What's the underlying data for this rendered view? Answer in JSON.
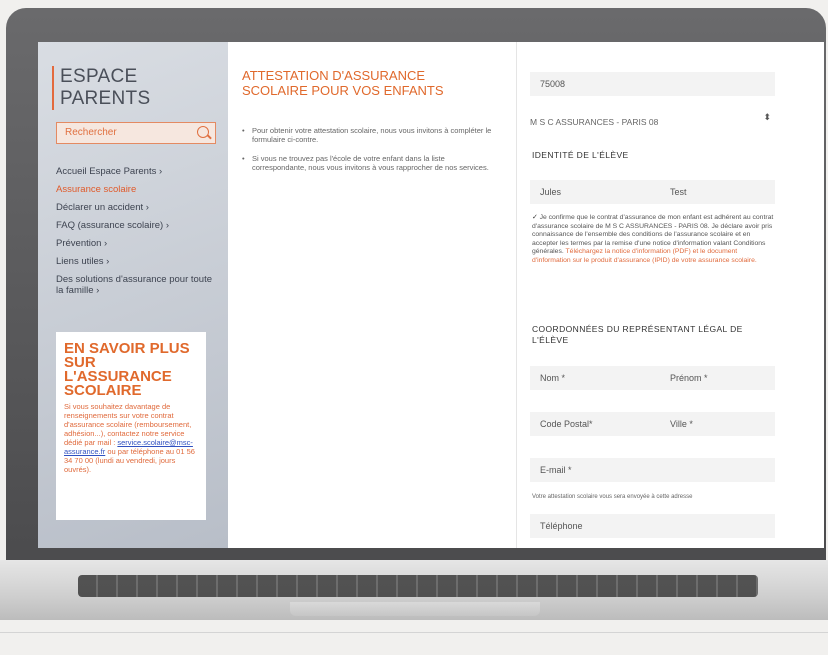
{
  "sidebar": {
    "logo": "ESPACE PARENTS",
    "search_placeholder": "Rechercher",
    "nav": [
      "Accueil Espace Parents  ›",
      "Assurance scolaire",
      "Déclarer un accident  ›",
      "FAQ (assurance scolaire)  ›",
      "Prévention  ›",
      "Liens utiles  ›",
      "Des solutions d'assurance pour toute la famille  ›"
    ],
    "active_index": 1,
    "info_title": "EN SAVOIR PLUS SUR L'ASSURANCE SCOLAIRE",
    "info_text": "Si vous souhaitez davantage de renseignements sur votre contrat d'assurance scolaire (remboursement, adhésion...), contactez notre service dédié par mail :",
    "info_link": "service.scolaire@msc-assurance.fr",
    "info_text2": "ou par téléphone au 01 56 34 70 00 (lundi au vendredi, jours ouvrés)."
  },
  "middle": {
    "title": "ATTESTATION D'ASSURANCE SCOLAIRE POUR VOS ENFANTS",
    "bullets": [
      "Pour obtenir votre attestation scolaire, nous vous invitons à compléter le formulaire ci-contre.",
      "Si vous ne trouvez pas l'école de votre enfant dans la liste correspondante, nous vous invitons à vous rapprocher de nos services."
    ]
  },
  "form": {
    "postal_value": "75008",
    "agency_value": "M S C ASSURANCES - PARIS 08",
    "identity_heading": "IDENTITÉ DE L'ÉLÈVE",
    "first_name": "Jules",
    "last_name": "Test",
    "consent_text": "Je confirme que le contrat d'assurance de mon enfant est adhérent au contrat d'assurance scolaire de M S C ASSURANCES - PARIS 08. Je déclare avoir pris connaissance de l'ensemble des conditions de l'assurance scolaire et en accepter les termes par la remise d'une notice d'information valant Conditions générales.",
    "consent_link": "Téléchargez la notice d'information (PDF) et le document d'information sur le produit d'assurance (IPID) de votre assurance scolaire.",
    "rep_heading": "COORDONNÉES DU REPRÉSENTANT LÉGAL DE L'ÉLÈVE",
    "nom_label": "Nom *",
    "prenom_label": "Prénom *",
    "cp_label": "Code Postal*",
    "ville_label": "Ville *",
    "email_label": "E-mail *",
    "small_note": "Votre attestation scolaire vous sera envoyée à cette adresse",
    "tel_label": "Téléphone"
  }
}
